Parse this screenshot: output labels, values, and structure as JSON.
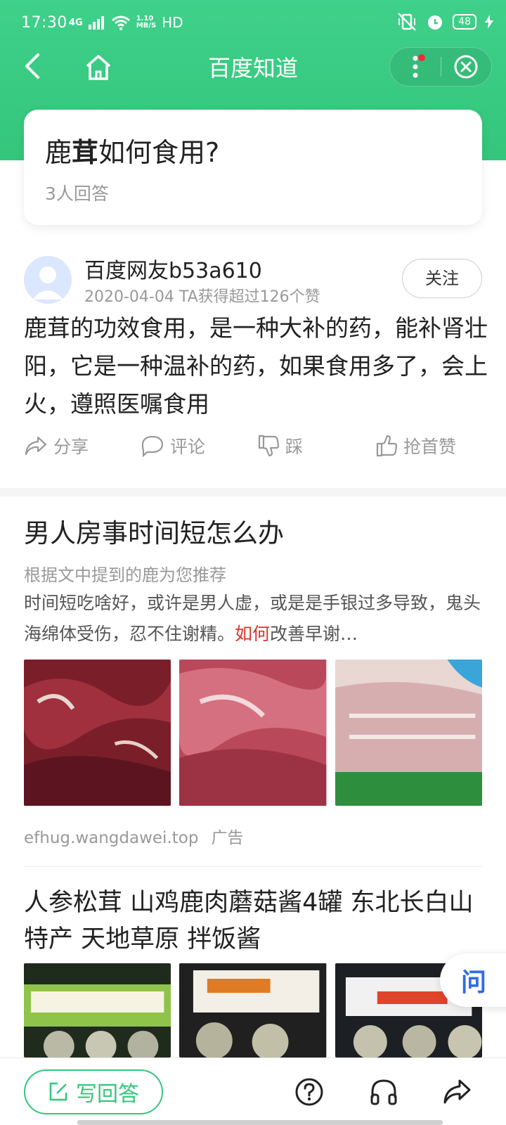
{
  "status_bar": {
    "time": "17:30",
    "network": "4G",
    "speed": "1.10\nMB/S",
    "hd": "HD",
    "battery": "48"
  },
  "nav": {
    "title": "百度知道"
  },
  "question": {
    "title_prefix": "鹿",
    "title_bold": "茸",
    "title_suffix": "如何食用?",
    "answer_count": "3人回答"
  },
  "answer": {
    "username": "百度网友b53a610",
    "date": "2020-04-04",
    "likes_info": "TA获得超过126个赞",
    "follow_label": "关注",
    "text": "鹿茸的功效食用，是一种大补的药，能补肾壮阳，它是一种温补的药，如果食用多了，会上火，遵照医嘱食用",
    "actions": {
      "share": "分享",
      "comment": "评论",
      "dislike": "踩",
      "first_like": "抢首赞"
    }
  },
  "ad1": {
    "title": "男人房事时间短怎么办",
    "subtitle": "根据文中提到的鹿为您推荐",
    "desc_before": "时间短吃啥好，或许是男人虚，或是是手银过多导致，鬼头海绵体受伤，忍不住谢精。",
    "desc_highlight": "如何",
    "desc_after": "改善早谢…",
    "source": "efhug.wangdawei.top",
    "tag": "广告"
  },
  "ad2": {
    "title": "人参松茸 山鸡鹿肉蘑菇酱4罐 东北长白山特产 天地草原 拌饭酱"
  },
  "float_button": {
    "label": "问"
  },
  "bottom_bar": {
    "write_label": "写回答"
  },
  "colors": {
    "brand_green": "#34c67b",
    "highlight_red": "#e0322c",
    "ask_blue": "#2f6de1"
  }
}
